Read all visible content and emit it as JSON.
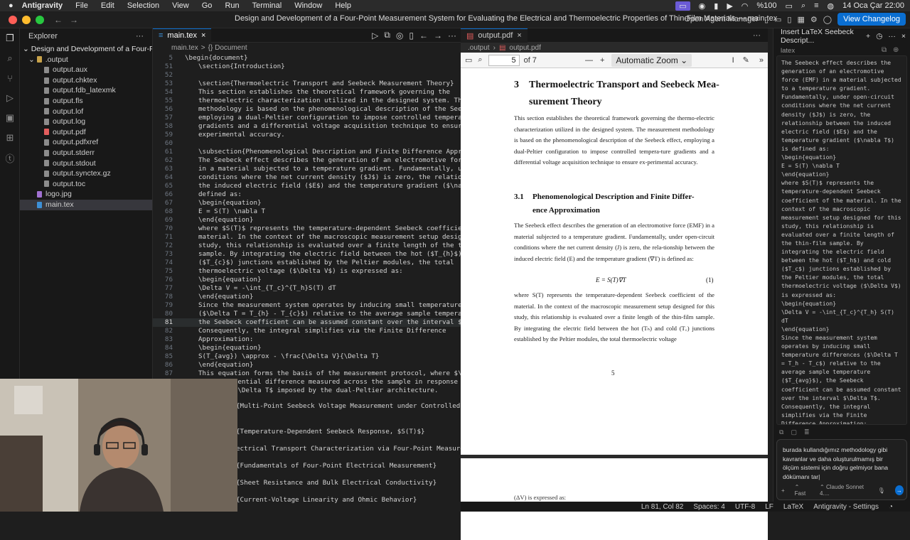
{
  "menubar": {
    "app": "Antigravity",
    "items": [
      "File",
      "Edit",
      "Selection",
      "View",
      "Go",
      "Run",
      "Terminal",
      "Window",
      "Help"
    ],
    "battery": "%100",
    "clock": "14 Oca Çar  22:00"
  },
  "window": {
    "title": "Design and Development of a Four-Point Measurement System for Evaluating the Electrical and Thermoelectric Properties of Thin-Film Materials — main.tex",
    "agent_manager": "Open Agent Manager",
    "changelog": "View Changelog"
  },
  "explorer": {
    "header": "Explorer",
    "root": "Design and Development of a Four-Point M...",
    "folder": ".output",
    "files": [
      "output.aux",
      "output.chktex",
      "output.fdb_latexmk",
      "output.fls",
      "output.lof",
      "output.log",
      "output.pdf",
      "output.pdfxref",
      "output.stderr",
      "output.stdout",
      "output.synctex.gz",
      "output.toc"
    ],
    "rootfiles": [
      "logo.jpg",
      "main.tex"
    ]
  },
  "editor": {
    "tab": "main.tex",
    "crumb_file": "main.tex",
    "crumb_sep": ">",
    "crumb_doc": "{} Document",
    "lines": [
      {
        "n": "5",
        "t": "\\begin{document}"
      },
      {
        "n": "51",
        "t": "    \\section{Introduction}"
      },
      {
        "n": "52",
        "t": ""
      },
      {
        "n": "53",
        "t": "    \\section{Thermoelectric Transport and Seebeck Measurement Theory}"
      },
      {
        "n": "54",
        "t": "    This section establishes the theoretical framework governing the"
      },
      {
        "n": "55",
        "t": "    thermoelectric characterization utilized in the designed system. The measurem"
      },
      {
        "n": "56",
        "t": "    methodology is based on the phenomenological description of the Seebeck effec"
      },
      {
        "n": "57",
        "t": "    employing a dual-Peltier configuration to impose controlled temperature"
      },
      {
        "n": "58",
        "t": "    gradients and a differential voltage acquisition technique to ensure"
      },
      {
        "n": "59",
        "t": "    experimental accuracy."
      },
      {
        "n": "60",
        "t": ""
      },
      {
        "n": "61",
        "t": "    \\subsection{Phenomenological Description and Finite Difference Approximation}"
      },
      {
        "n": "62",
        "t": "    The Seebeck effect describes the generation of an electromotive force (EMF)"
      },
      {
        "n": "63",
        "t": "    in a material subjected to a temperature gradient. Fundamentally, under open-"
      },
      {
        "n": "64",
        "t": "    conditions where the net current density ($J$) is zero, the relationship betw"
      },
      {
        "n": "65",
        "t": "    the induced electric field ($E$) and the temperature gradient ($\\nabla T$) is"
      },
      {
        "n": "66",
        "t": "    defined as:"
      },
      {
        "n": "67",
        "t": "    \\begin{equation}"
      },
      {
        "n": "68",
        "t": "        E = S(T) \\nabla T"
      },
      {
        "n": "69",
        "t": "    \\end{equation}"
      },
      {
        "n": "70",
        "t": "    where $S(T)$ represents the temperature-dependent Seebeck coefficient of the"
      },
      {
        "n": "71",
        "t": "    material. In the context of the macroscopic measurement setup designed for th"
      },
      {
        "n": "72",
        "t": "    study, this relationship is evaluated over a finite length of the thin-film"
      },
      {
        "n": "73",
        "t": "    sample. By integrating the electric field between the hot ($T_{h}$) and cold-"
      },
      {
        "n": "74",
        "t": "    ($T_{c}$) junctions established by the Peltier modules, the total"
      },
      {
        "n": "75",
        "t": "    thermoelectric voltage ($\\Delta V$) is expressed as:"
      },
      {
        "n": "76",
        "t": "    \\begin{equation}"
      },
      {
        "n": "77",
        "t": "        \\Delta V = -\\int_{T_c}^{T_h}S(T) dT"
      },
      {
        "n": "78",
        "t": "    \\end{equation}"
      },
      {
        "n": "79",
        "t": "    Since the measurement system operates by inducing small temperature differenc"
      },
      {
        "n": "80",
        "t": "    ($\\Delta T = T_{h} - T_{c}$) relative to the average sample temperature ($T_"
      },
      {
        "n": "81",
        "t": "    the Seebeck coefficient can be assumed constant over the interval $\\Delta T$"
      },
      {
        "n": "82",
        "t": "    Consequently, the integral simplifies via the Finite Difference"
      },
      {
        "n": "83",
        "t": "    Approximation:"
      },
      {
        "n": "84",
        "t": "    \\begin{equation}"
      },
      {
        "n": "85",
        "t": "        S(T_{avg}) \\approx - \\frac{\\Delta V}{\\Delta T}"
      },
      {
        "n": "86",
        "t": "    \\end{equation}"
      },
      {
        "n": "87",
        "t": "    This equation forms the basis of the measurement protocol, where $\\Delta V$"
      },
      {
        "n": "88",
        "t": "    the differential difference measured across the sample in response to the"
      },
      {
        "n": "89",
        "t": "    gradient $\\Delta T$ imposed by the dual-Peltier architecture."
      }
    ],
    "folded": [
      "{Multi-Point Seebeck Voltage Measurement under Controlled Thermal",
      "{Temperature-Dependent Seebeck Response, $S(T)$}",
      "ectrical Transport Characterization via Four-Point Measurements}",
      "{Fundamentals of Four-Point Electrical Measurement}",
      "{Sheet Resistance and Bulk Electrical Conductivity}",
      "{Current-Voltage Linearity and Ohmic Behavior}"
    ]
  },
  "pdf": {
    "tab": "output.pdf",
    "crumb_dir": ".output",
    "crumb_file": "output.pdf",
    "page": "5",
    "of": "of 7",
    "zoom": "Automatic Zoom",
    "section_num": "3",
    "section_title_1": "Thermoelectric Transport and Seebeck Mea-",
    "section_title_2": "surement Theory",
    "para1": "This section establishes the theoretical framework governing the thermo-electric characterization utilized in the designed system. The measurement methodology is based on the phenomenological description of the Seebeck effect, employing a dual-Peltier configuration to impose controlled tempera-ture gradients and a differential voltage acquisition technique to ensure ex-perimental accuracy.",
    "sub_num": "3.1",
    "sub_title_1": "Phenomenological Description and Finite Differ-",
    "sub_title_2": "ence Approximation",
    "para2": "The Seebeck effect describes the generation of an electromotive force (EMF) in a material subjected to a temperature gradient. Fundamentally, under open-circuit conditions where the net current density (J) is zero, the rela-tionship between the induced electric field (E) and the temperature gradient (∇T) is defined as:",
    "equation": "E = S(T)∇T",
    "eq_no": "(1)",
    "para3": "where S(T) represents the temperature-dependent Seebeck coefficient of the material. In the context of the macroscopic measurement setup designed for this study, this relationship is evaluated over a finite length of the thin-film sample. By integrating the electric field between the hot (Tₕ) and cold (T꜀) junctions established by the Peltier modules, the total thermoelectric voltage",
    "page_number": "5",
    "next_page_text": "(ΔV) is expressed as:"
  },
  "chat": {
    "title": "Insert LaTeX Seebeck Descript...",
    "lang": "latex",
    "code": "The Seebeck effect describes the generation of an electromotive force (EMF) in a material subjected to a temperature gradient. Fundamentally, under open-circuit conditions where the net current density ($J$) is zero, the relationship between the induced electric field ($E$) and the temperature gradient ($\\nabla T$) is defined as:\n\\begin{equation}\nE = S(T) \\nabla T\n\\end{equation}\nwhere $S(T)$ represents the temperature-dependent Seebeck coefficient of the material. In the context of the macroscopic measurement setup designed for this study, this relationship is evaluated over a finite length of the thin-film sample. By integrating the electric field between the hot ($T_h$) and cold ($T_c$) junctions established by the Peltier modules, the total thermoelectric voltage ($\\Delta V$) is expressed as:\n\\begin{equation}\n\\Delta V = -\\int_{T_c}^{T_h} S(T) dT\n\\end{equation}\nSince the measurement system operates by inducing small temperature differences ($\\Delta T = T_h - T_c$) relative to the average sample temperature ($T_{avg}$), the Seebeck coefficient can be assumed constant over the interval $\\Delta T$. Consequently, the integral simplifies via the Finite Difference Approximation:\n\\begin{equation}\nS(T_{avg}) \\approx - \\frac{\\Delta V}{\\Delta T}",
    "input": "burada kullandığımız methodology gibi kavranlar ve daha oluşturulmamış bir ölçüm sistemi için doğru gelmiyor bana dökümanı tar|",
    "mode": "Fast",
    "model": "Claude Sonnet 4...."
  },
  "status": {
    "pos": "Ln 81, Col 82",
    "spaces": "Spaces: 4",
    "enc": "UTF-8",
    "eol": "LF",
    "lang": "LaTeX",
    "settings": "Antigravity - Settings"
  },
  "colors": {
    "accent": "#0a6ed1",
    "folder": "#c8a24a",
    "pdf": "#e35d5d",
    "tex": "#3d8fd6"
  }
}
